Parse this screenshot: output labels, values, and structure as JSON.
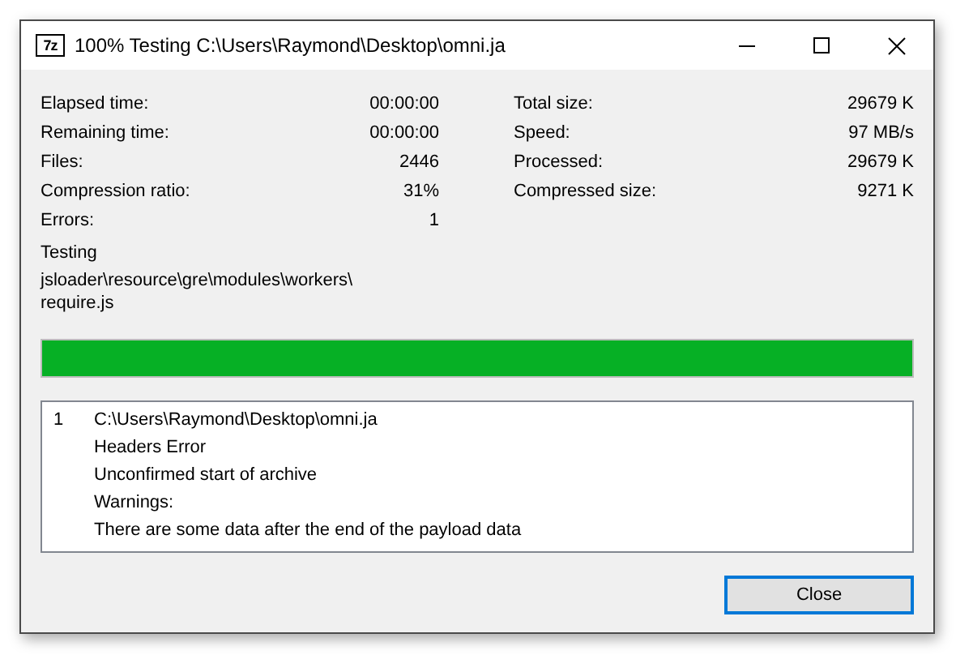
{
  "window": {
    "icon_text": "7z",
    "title": "100% Testing C:\\Users\\Raymond\\Desktop\\omni.ja"
  },
  "stats_left": [
    {
      "label": "Elapsed time:",
      "value": "00:00:00"
    },
    {
      "label": "Remaining time:",
      "value": "00:00:00"
    },
    {
      "label": "Files:",
      "value": "2446"
    },
    {
      "label": "Compression ratio:",
      "value": "31%"
    },
    {
      "label": "Errors:",
      "value": "1"
    }
  ],
  "stats_right": [
    {
      "label": "Total size:",
      "value": "29679 K"
    },
    {
      "label": "Speed:",
      "value": "97 MB/s"
    },
    {
      "label": "Processed:",
      "value": "29679 K"
    },
    {
      "label": "Compressed size:",
      "value": "9271 K"
    }
  ],
  "operation": "Testing",
  "current_file": "jsloader\\resource\\gre\\modules\\workers\\ require.js",
  "progress": {
    "level": 1.0
  },
  "log": [
    {
      "number": "1",
      "lines": [
        "C:\\Users\\Raymond\\Desktop\\omni.ja",
        "Headers Error",
        "Unconfirmed start of archive",
        "Warnings:",
        "There are some data after the end of the payload data"
      ]
    }
  ],
  "buttons": [
    "Close"
  ]
}
